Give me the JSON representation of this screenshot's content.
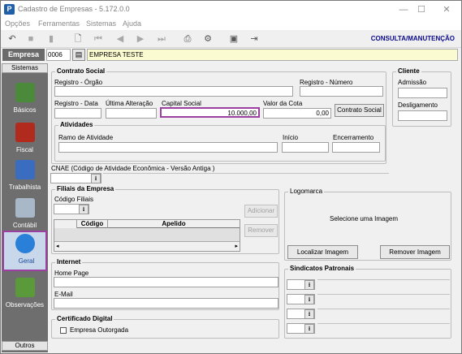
{
  "window": {
    "title": "Cadastro de Empresas - 5.172.0.0",
    "app_icon": "P",
    "min": "—",
    "max": "☐",
    "close": "✕"
  },
  "menu": [
    "Opções",
    "Ferramentas",
    "Sistemas",
    "Ajuda"
  ],
  "toolbar": {
    "mode": "CONSULTA/MANUTENÇÃO"
  },
  "empresa": {
    "label": "Empresa",
    "code": "0006",
    "name": "EMPRESA TESTE"
  },
  "sidebar": {
    "header": "Sistemas",
    "footer": "Outros",
    "items": [
      "Básicos",
      "Fiscal",
      "Trabalhista",
      "Contábil",
      "Geral",
      "Observações"
    ],
    "selected": "Geral"
  },
  "contrato": {
    "title": "Contrato Social",
    "registro_orgao": "Registro - Órgão",
    "registro_numero": "Registro - Número",
    "registro_data": "Registro - Data",
    "ultima_alteracao": "Última Alteração",
    "capital_social": "Capital Social",
    "capital_value": "10.000,00",
    "valor_cota": "Valor da Cota",
    "cota_value": "0,00",
    "button": "Contrato Social"
  },
  "atividades": {
    "title": "Atividades",
    "ramo": "Ramo de Atividade",
    "inicio": "Início",
    "encerramento": "Encerramento"
  },
  "cliente": {
    "title": "Cliente",
    "admissao": "Admissão",
    "desligamento": "Desligamento"
  },
  "cnae": {
    "label": "CNAE (Código de Atividade Econômica - Versão Antiga )"
  },
  "filiais": {
    "title": "Filiais da Empresa",
    "codigo": "Código Filiais",
    "adicionar": "Adicionar",
    "remover": "Remover",
    "columns": [
      "Código",
      "Apelido"
    ]
  },
  "logomarca": {
    "title": "Logomarca",
    "placeholder": "Selecione  uma  Imagem",
    "localizar": "Localizar Imagem",
    "remover": "Remover Imagem"
  },
  "internet": {
    "title": "Internet",
    "homepage": "Home Page",
    "email": "E-Mail"
  },
  "sindicatos": {
    "title": "Sindicatos Patronais"
  },
  "certificado": {
    "title": "Certificado Digital",
    "checkbox": "Empresa Outorgada"
  },
  "colors": {
    "accent": "#9b3fa0",
    "sidebar": "#6e6e6e",
    "mode_text": "#0a0a8c"
  }
}
